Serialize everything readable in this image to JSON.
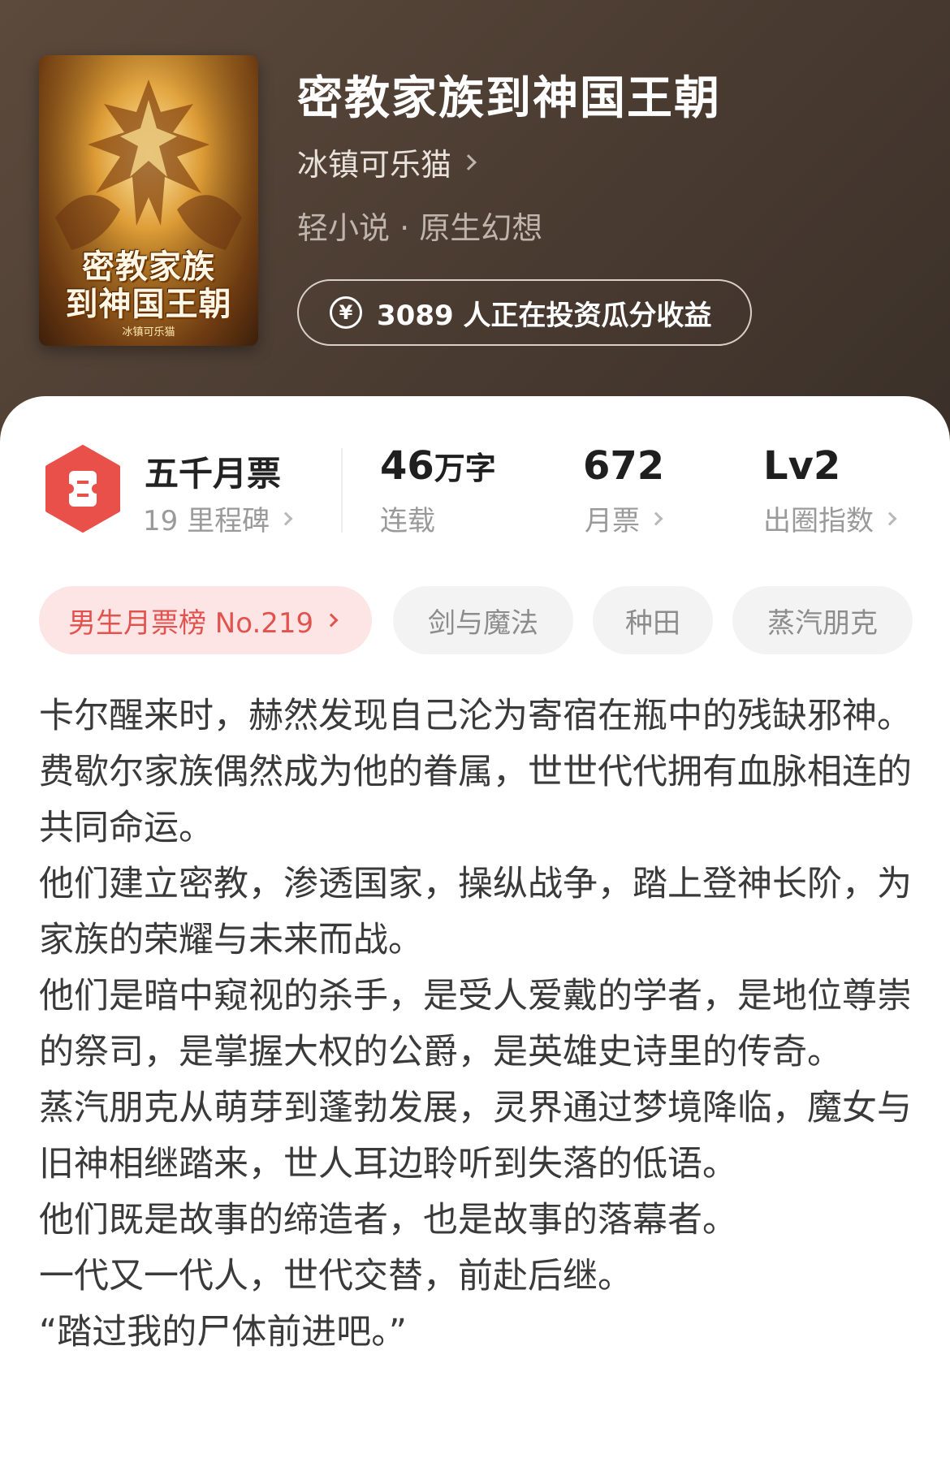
{
  "book": {
    "cover_title_line1": "密教家族",
    "cover_title_line2": "到神国王朝",
    "cover_author": "冰镇可乐猫",
    "title": "密教家族到神国王朝",
    "author": "冰镇可乐猫",
    "genre": "轻小说 · 原生幻想",
    "invest_text": "3089 人正在投资瓜分收益"
  },
  "stats": {
    "ticket_title": "五千月票",
    "ticket_sub": "19 里程碑",
    "words_value": "46",
    "words_unit": "万字",
    "words_sub": "连载",
    "votes_value": "672",
    "votes_sub": "月票",
    "level_value": "Lv2",
    "level_sub": "出圈指数"
  },
  "tags": {
    "rank": "男生月票榜 No.219",
    "tag1": "剑与魔法",
    "tag2": "种田",
    "tag3": "蒸汽朋克"
  },
  "synopsis": [
    "卡尔醒来时，赫然发现自己沦为寄宿在瓶中的残缺邪神。",
    "费歇尔家族偶然成为他的眷属，世世代代拥有血脉相连的共同命运。",
    "他们建立密教，渗透国家，操纵战争，踏上登神长阶，为家族的荣耀与未来而战。",
    "他们是暗中窥视的杀手，是受人爱戴的学者，是地位尊崇的祭司，是掌握大权的公爵，是英雄史诗里的传奇。",
    "蒸汽朋克从萌芽到蓬勃发展，灵界通过梦境降临，魔女与旧神相继踏来，世人耳边聆听到失落的低语。",
    "他们既是故事的缔造者，也是故事的落幕者。",
    "一代又一代人，世代交替，前赴后继。",
    "“踏过我的尸体前进吧。”"
  ],
  "colors": {
    "header_bg": "#4f3f34",
    "accent_red": "#e2534f",
    "rank_tag_bg": "#fde5e5"
  },
  "icons": {
    "ticket": "ticket-icon",
    "yen": "yen-coin-icon",
    "chevron": "chevron-right-icon"
  }
}
